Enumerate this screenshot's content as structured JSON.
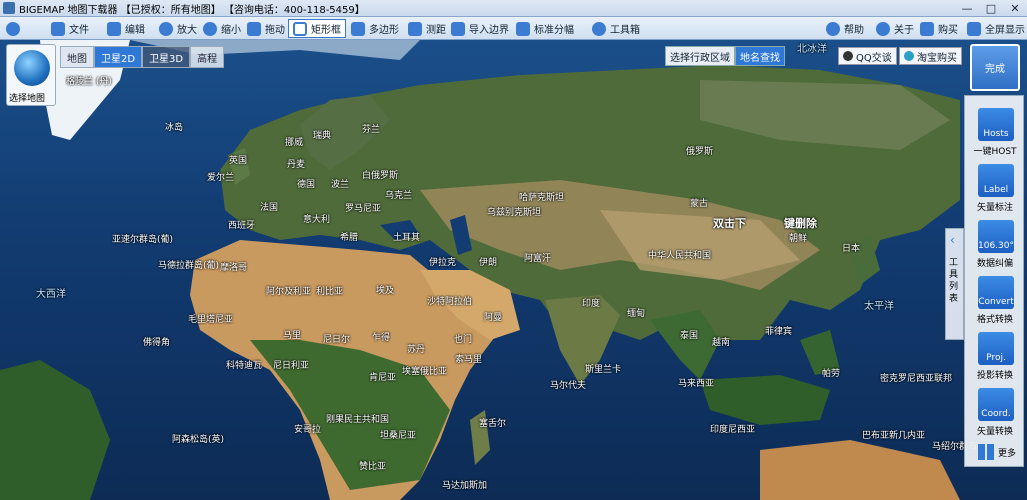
{
  "window": {
    "title": "BIGEMAP 地图下载器 【已授权：所有地图】 【咨询电话：400-118-5459】",
    "min_icon": "minimize-icon",
    "max_icon": "maximize-icon",
    "close_icon": "close-icon"
  },
  "toolbar": {
    "file": "文件",
    "edit": "编辑",
    "zoom_in": "放大",
    "zoom_out": "缩小",
    "pan": "拖动",
    "rect": "矩形框",
    "polygon": "多边形",
    "measure": "测距",
    "import": "导入边界",
    "standard_split": "标准分幅",
    "toolbox": "工具箱",
    "help": "帮助",
    "about": "关于",
    "buy": "购买",
    "fullscreen": "全屏显示"
  },
  "map_selector": {
    "label": "选择地图",
    "tabs": [
      "地图",
      "卫星2D",
      "卫星3D",
      "高程"
    ],
    "active_tab": "卫星2D"
  },
  "region": {
    "select_region": "选择行政区域",
    "place_search": "地名查找"
  },
  "links": {
    "qq": "QQ交谈",
    "taobao": "淘宝购买"
  },
  "done_button": "完成",
  "side_tab": {
    "text": "工具列表"
  },
  "tools": [
    {
      "tile": "Hosts",
      "label": "一键HOST"
    },
    {
      "tile": "Label",
      "label": "矢量标注"
    },
    {
      "tile": "106.30°",
      "label": "数据纠偏"
    },
    {
      "tile": "Convert",
      "label": "格式转换"
    },
    {
      "tile": "Proj.",
      "label": "投影转换"
    },
    {
      "tile": "Coord.",
      "label": "矢量转换"
    }
  ],
  "more": "更多",
  "map_labels": {
    "greenland": "格陵兰 (丹)",
    "iceland": "冰岛",
    "norway": "挪威",
    "sweden": "瑞典",
    "finland": "芬兰",
    "uk": "英国",
    "ireland": "爱尔兰",
    "denmark": "丹麦",
    "germany": "德国",
    "poland": "波兰",
    "belarus": "白俄罗斯",
    "france": "法国",
    "ukraine": "乌克兰",
    "romania": "罗马尼亚",
    "spain": "西班牙",
    "italy": "意大利",
    "greece": "希腊",
    "turkey": "土耳其",
    "azores": "亚速尔群岛(葡)",
    "madeira": "马德拉群岛(葡)",
    "morocco": "摩洛哥",
    "algeria": "阿尔及利亚",
    "libya": "利比亚",
    "egypt": "埃及",
    "saudi": "沙特阿拉伯",
    "iran": "伊朗",
    "iraq": "伊拉克",
    "kazakhstan": "哈萨克斯坦",
    "uzbek": "乌兹别克斯坦",
    "afghan": "阿富汗",
    "india": "印度",
    "russia": "俄罗斯",
    "mongolia": "蒙古",
    "china": "中华人民共和国",
    "dprk": "朝鲜",
    "japan": "日本",
    "mauritania": "毛里塔尼亚",
    "mali": "马里",
    "niger": "尼日尔",
    "chad": "乍得",
    "sudan": "苏丹",
    "nigeria": "尼日利亚",
    "ethiopia": "埃塞俄比亚",
    "somalia": "索马里",
    "kenya": "肯尼亚",
    "drc": "刚果民主共和国",
    "tanzania": "坦桑尼亚",
    "angola": "安哥拉",
    "zambia": "赞比亚",
    "madagascar": "马达加斯加",
    "cape_verde": "佛得角",
    "ivory": "科特迪瓦",
    "yemen": "也门",
    "oman": "阿曼",
    "myanmar": "缅甸",
    "thailand": "泰国",
    "vietnam": "越南",
    "philippines": "菲律宾",
    "malaysia": "马来西亚",
    "indonesia": "印度尼西亚",
    "sri_lanka": "斯里兰卡",
    "maldives": "马尔代夫",
    "seychelles": "塞舌尔",
    "png": "巴布亚新几内亚",
    "palau": "帕劳",
    "micronesia": "密克罗尼西亚联邦",
    "marshall": "马绍尔群岛",
    "ascension": "阿森松岛(英)",
    "atlantic": "大西洋",
    "pacific": "太平洋",
    "arctic": "北冰洋",
    "double_click": "双击下",
    "right_click": "键删除"
  },
  "colors": {
    "accent": "#2f78d6",
    "toolbar_bg": "#dbe7f4"
  }
}
